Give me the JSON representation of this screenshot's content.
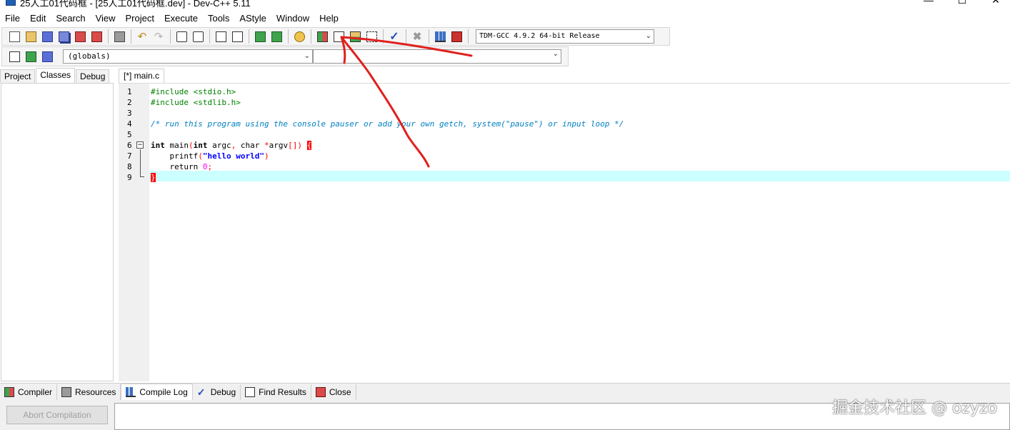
{
  "window": {
    "title": "25人工01代码框 - [25人工01代码框.dev] - Dev-C++ 5.11",
    "minimize": "—",
    "maximize": "☐",
    "close": "✕"
  },
  "menu": [
    "File",
    "Edit",
    "Search",
    "View",
    "Project",
    "Execute",
    "Tools",
    "AStyle",
    "Window",
    "Help"
  ],
  "toolbar": {
    "compiler_selected": "TDM-GCC 4.9.2 64-bit Release",
    "scope_selected": "(globals)",
    "member_selected": ""
  },
  "left_panel": {
    "tabs": [
      "Project",
      "Classes",
      "Debug"
    ],
    "active_tab": "Classes"
  },
  "editor": {
    "tab_label": "[*] main.c",
    "line_numbers": [
      "1",
      "2",
      "3",
      "4",
      "5",
      "6",
      "7",
      "8",
      "9"
    ],
    "current_line": 9,
    "lines": [
      "#include <stdio.h>",
      "#include <stdlib.h>",
      "",
      "/* run this program using the console pauser or add your own getch, system(\"pause\") or input loop */",
      "",
      "int main(int argc, char *argv[]) {",
      "    printf(\"hello world\")",
      "    return 0;",
      "}"
    ]
  },
  "bottom_panel": {
    "tabs": [
      "Compiler",
      "Resources",
      "Compile Log",
      "Debug",
      "Find Results",
      "Close"
    ],
    "active_tab": "Compile Log",
    "abort_label": "Abort Compilation"
  },
  "watermark": "掘金技术社区 @ ozyzo",
  "annotation_color": "#e0201c"
}
